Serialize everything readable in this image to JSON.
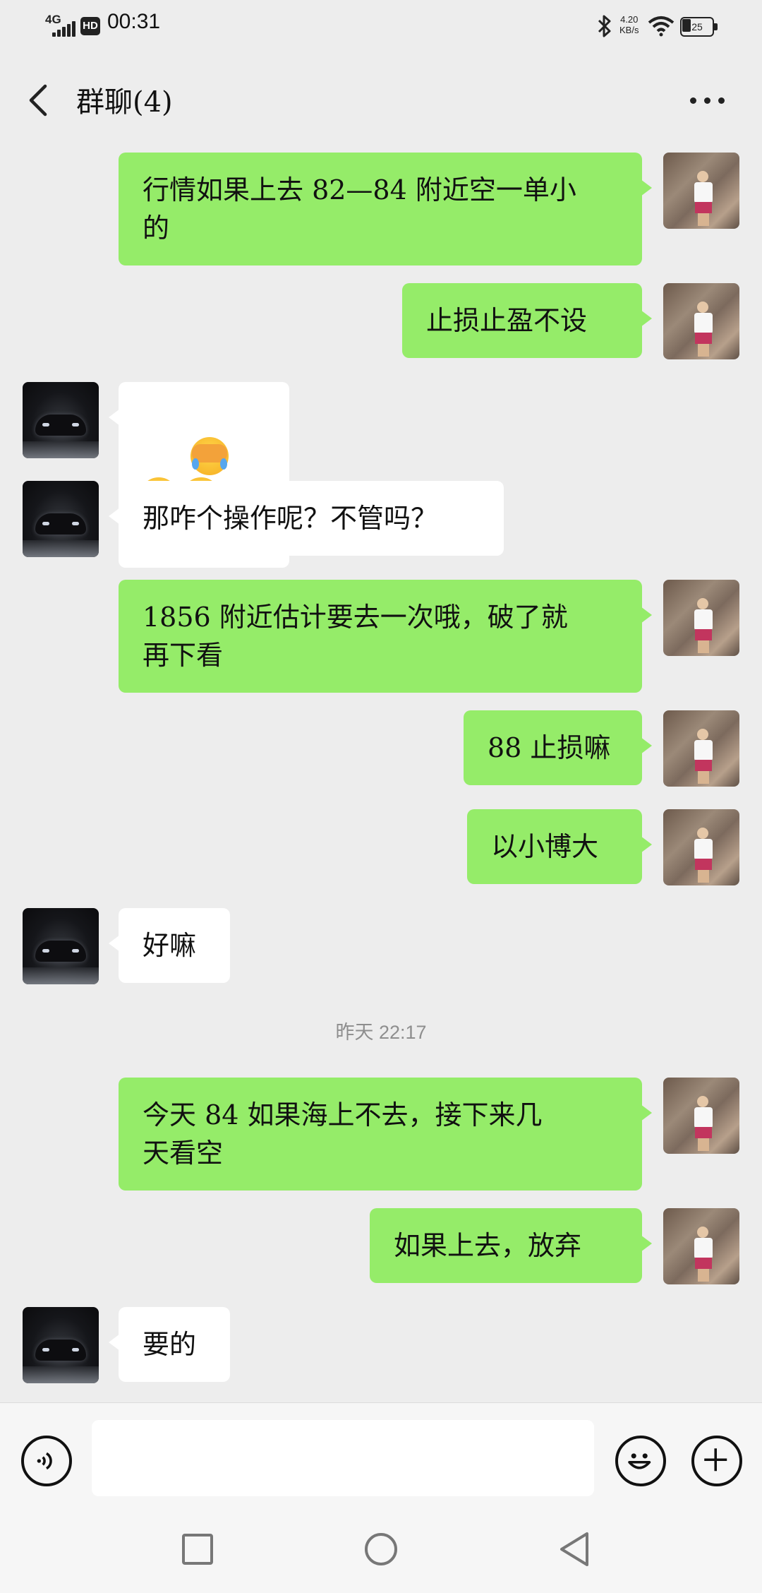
{
  "status_bar": {
    "network": "4G",
    "hd_badge": "HD",
    "time": "00:31",
    "speed_value": "4.20",
    "speed_unit": "KB/s",
    "battery": "25",
    "icons": [
      "signal-icon",
      "bluetooth-icon",
      "wifi-icon",
      "battery-icon"
    ]
  },
  "header": {
    "title": "群聊(4)",
    "back_icon": "chevron-left-icon",
    "more_icon": "more-dots-icon"
  },
  "colors": {
    "background": "#ededed",
    "bubble_self": "#95ec69",
    "bubble_other": "#ffffff",
    "timestamp_text": "#8e8e8e"
  },
  "messages": [
    {
      "sender": "self",
      "text": "行情如果上去 82—84 附近空一单小\n的"
    },
    {
      "sender": "self",
      "text": "止损止盈不设"
    },
    {
      "sender": "other",
      "emoji": [
        "facepalm-crying-emoji",
        "facepalm-crying-emoji",
        "facepalm-crying-emoji"
      ]
    },
    {
      "sender": "other",
      "text": "那咋个操作呢？不管吗？"
    },
    {
      "sender": "self",
      "text": "1856 附近估计要去一次哦，破了就\n再下看"
    },
    {
      "sender": "self",
      "text": "88 止损嘛"
    },
    {
      "sender": "self",
      "text": "以小博大"
    },
    {
      "sender": "other",
      "text": "好嘛"
    },
    {
      "sender": "self",
      "text": "今天 84 如果海上不去，接下来几\n天看空"
    },
    {
      "sender": "self",
      "text": "如果上去，放弃"
    },
    {
      "sender": "other",
      "text": "要的"
    }
  ],
  "timestamp": "昨天 22:17",
  "input_bar": {
    "placeholder": "",
    "icons": [
      "voice-icon",
      "emoji-icon",
      "plus-icon"
    ]
  },
  "nav_bar": {
    "icons": [
      "recent-apps-icon",
      "home-icon",
      "back-triangle-icon"
    ]
  }
}
